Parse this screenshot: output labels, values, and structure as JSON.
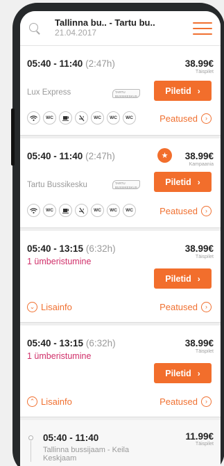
{
  "header": {
    "route": "Tallinna bu.. - Tartu bu..",
    "date": "21.04.2017"
  },
  "trips": [
    {
      "time": "05:40 - 11:40",
      "duration": "(2:47h)",
      "price": "38.99€",
      "price_type": "Täispilet",
      "operator": "Lux Express",
      "operator_logo_text": "TARTU BUSSIKESKUS",
      "button": "Piletid",
      "stops": "Peatused",
      "amenities": [
        "wifi",
        "wc",
        "coffee",
        "no-smoking",
        "wc",
        "wc",
        "wc"
      ]
    },
    {
      "time": "05:40 - 11:40",
      "duration": "(2:47h)",
      "price": "38.99€",
      "price_type": "Kampaania",
      "operator": "Tartu Bussikesku",
      "operator_logo_text": "TARTU BUSSIKESKUS",
      "button": "Piletid",
      "stops": "Peatused",
      "amenities": [
        "wifi",
        "wc",
        "coffee",
        "no-smoking",
        "wc",
        "wc",
        "wc"
      ]
    },
    {
      "time": "05:40 - 13:15",
      "duration": "(6:32h)",
      "price": "38.99€",
      "price_type": "Täispilet",
      "transfer": "1 ümberistumine",
      "button": "Piletid",
      "info": "Lisainfo",
      "stops": "Peatused"
    },
    {
      "time": "05:40 - 13:15",
      "duration": "(6:32h)",
      "price": "38.99€",
      "price_type": "Täispilet",
      "transfer": "1 ümberistumine",
      "button": "Piletid",
      "info": "Lisainfo",
      "stops": "Peatused"
    },
    {
      "time": "05:40 - 11:40",
      "price": "11.99€",
      "price_type": "Täispilet",
      "from_to": "Tallinna bussijaam - Keila Keskjaam"
    }
  ],
  "amenity_labels": {
    "wc": "WC"
  },
  "colors": {
    "accent": "#f26e2c",
    "transfer": "#d0306a"
  },
  "icons": [
    "search-icon",
    "menu-icon",
    "chevron-right-icon",
    "star-icon",
    "chevron-down-icon",
    "chevron-up-icon"
  ]
}
